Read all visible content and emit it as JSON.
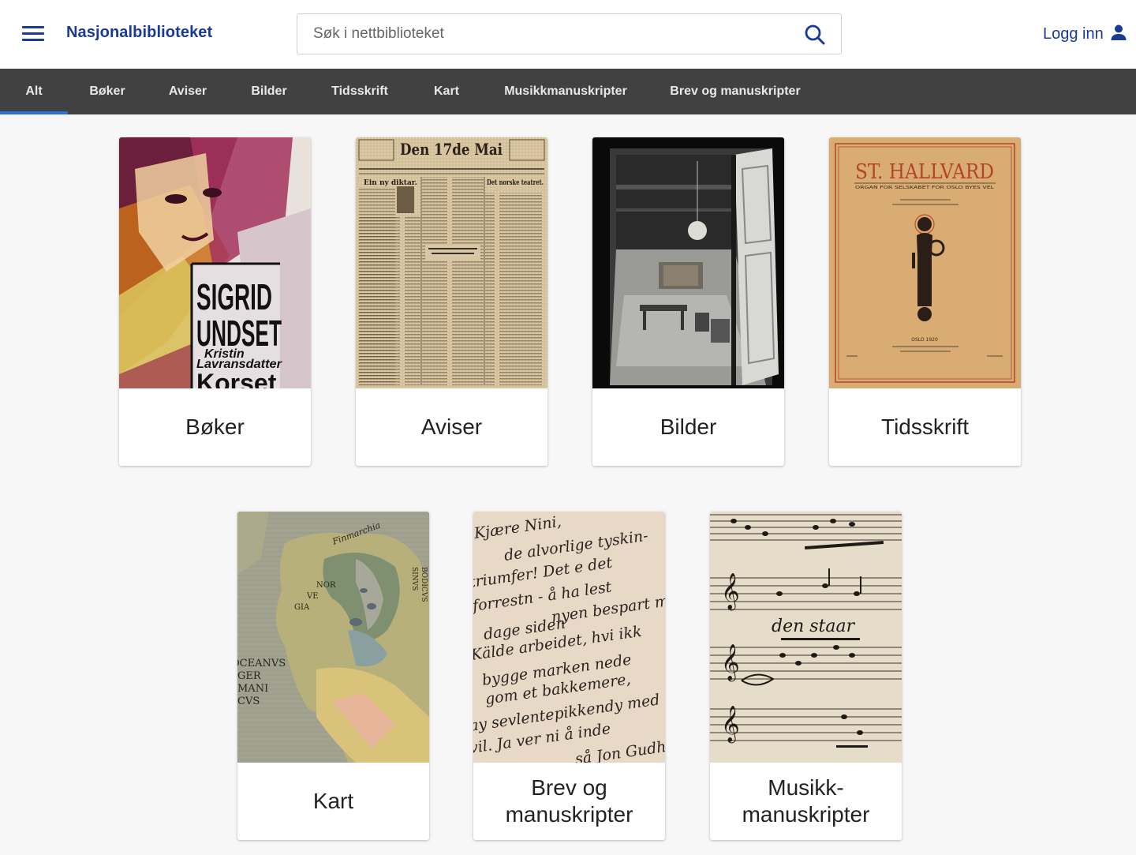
{
  "header": {
    "brand": "Nasjonalbiblioteket",
    "search_placeholder": "Søk i nettbiblioteket",
    "search_value": "",
    "login_label": "Logg inn"
  },
  "tabs": [
    {
      "label": "Alt",
      "active": true
    },
    {
      "label": "Bøker"
    },
    {
      "label": "Aviser"
    },
    {
      "label": "Bilder"
    },
    {
      "label": "Tidsskrift"
    },
    {
      "label": "Kart"
    },
    {
      "label": "Musikkmanuskripter"
    },
    {
      "label": "Brev og manuskripter"
    }
  ],
  "cards": [
    {
      "label": "Bøker",
      "cover_text": {
        "line1": "SIGRID",
        "line2": "UNDSET",
        "line3": "Kristin",
        "line4": "Lavransdatter",
        "line5": "Korset"
      }
    },
    {
      "label": "Aviser",
      "masthead": "Den 17de Mai",
      "headlines": [
        "Ein ny diktar.",
        "Det norske teatret."
      ]
    },
    {
      "label": "Bilder"
    },
    {
      "label": "Tidsskrift",
      "title": "ST. HALLVARD",
      "subtitle": "ORGAN FOR SELSKABET FOR OSLO BYES VEL",
      "footer": "OSLO 1920"
    },
    {
      "label": "Kart",
      "map_labels": [
        "Finmarchia",
        "NOR",
        "VE",
        "GIA",
        "OCEANVS",
        "GER",
        "MANI",
        "CVS",
        "SINVS",
        "BODICVS"
      ]
    },
    {
      "label": "Brev og manuskripter",
      "handwriting": [
        "Kjære Nini,",
        "de alvorlige tyskin-",
        "triumfer! Det e det",
        "forrestn - å ha lest",
        "nyen bespart mig",
        "dage siden",
        "Kälde arbeidet, hvi ikk",
        "bygge marken nede",
        "gom et bakkemere,",
        "ay sevlentepikkendy med ra",
        "vil. Ja ver ni å inde",
        "så Jon Gudh"
      ]
    },
    {
      "label": "Musikk-manuskripter",
      "label_lines": [
        "Musikk-",
        "manuskripter"
      ],
      "lyric": "den staar"
    }
  ],
  "colors": {
    "brand": "#1a3a9a",
    "tabbar": "#414141",
    "tab_indicator": "#2a6fdb",
    "page_bg": "#f7f7f7"
  },
  "icons": {
    "menu": "hamburger-menu-icon",
    "search": "search-icon",
    "user": "user-icon"
  }
}
